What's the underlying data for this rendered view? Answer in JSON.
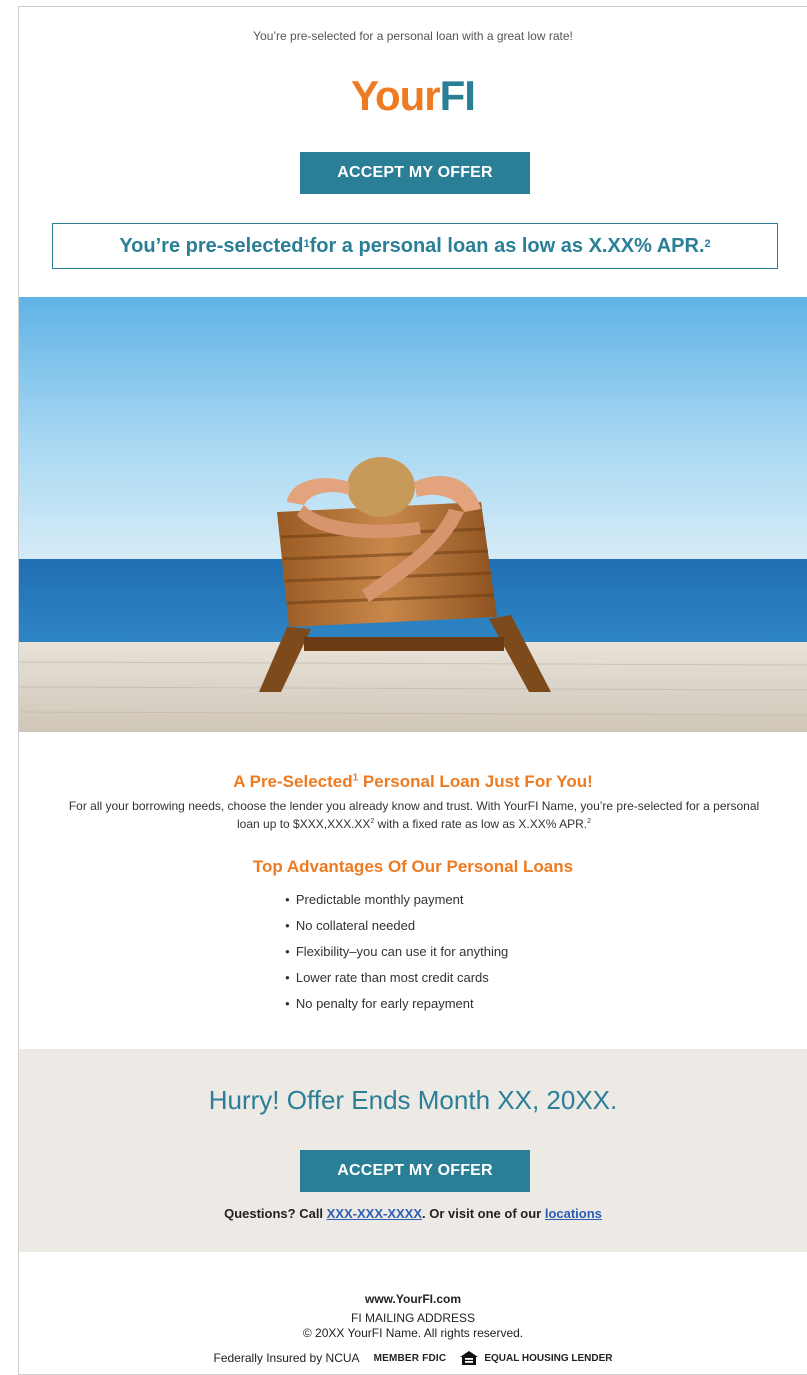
{
  "preheader": "You’re pre-selected for a personal loan with a great low rate!",
  "logo": {
    "part1": "Your",
    "part2": "FI"
  },
  "cta_top": "ACCEPT MY OFFER",
  "offer_box": {
    "text_a": "You’re pre-selected",
    "sup_a": "1",
    "text_b": " for a personal loan as low as X.XX% APR.",
    "sup_b": "2"
  },
  "hero": {
    "icon": "beach-lounger-photo"
  },
  "section1": {
    "title_a": "A Pre-Selected",
    "title_sup": "1",
    "title_b": " Personal Loan Just For You!",
    "body_a": "For all your borrowing needs, choose the lender you already know and trust. With YourFI Name, you’re pre-selected for a personal loan up to $XXX,XXX.XX",
    "body_sup1": "2",
    "body_b": " with a fixed rate as low as X.XX% APR.",
    "body_sup2": "2"
  },
  "section2": {
    "title": "Top Advantages Of Our Personal Loans",
    "items": [
      "Predictable monthly payment",
      "No collateral needed",
      "Flexibility–you can use it for anything",
      "Lower rate than most credit cards",
      "No penalty for early repayment"
    ]
  },
  "band": {
    "hurry": "Hurry! Offer Ends Month XX, 20XX.",
    "cta": "ACCEPT MY OFFER",
    "questions_a": "Questions? Call ",
    "phone": "XXX-XXX-XXXX",
    "questions_b": ". Or visit one of our ",
    "locations": "locations"
  },
  "footer": {
    "url": "www.YourFI.com",
    "address": "FI MAILING ADDRESS",
    "copyright": "© 20XX YourFI Name. All rights reserved.",
    "ncua": "Federally Insured by NCUA",
    "fdic": "MEMBER FDIC",
    "ehl": "EQUAL HOUSING LENDER"
  },
  "colors": {
    "brand_teal": "#2a7f97",
    "brand_orange": "#ee7b22",
    "band_gray": "#ede9e5",
    "link_blue": "#2b5fb4"
  }
}
